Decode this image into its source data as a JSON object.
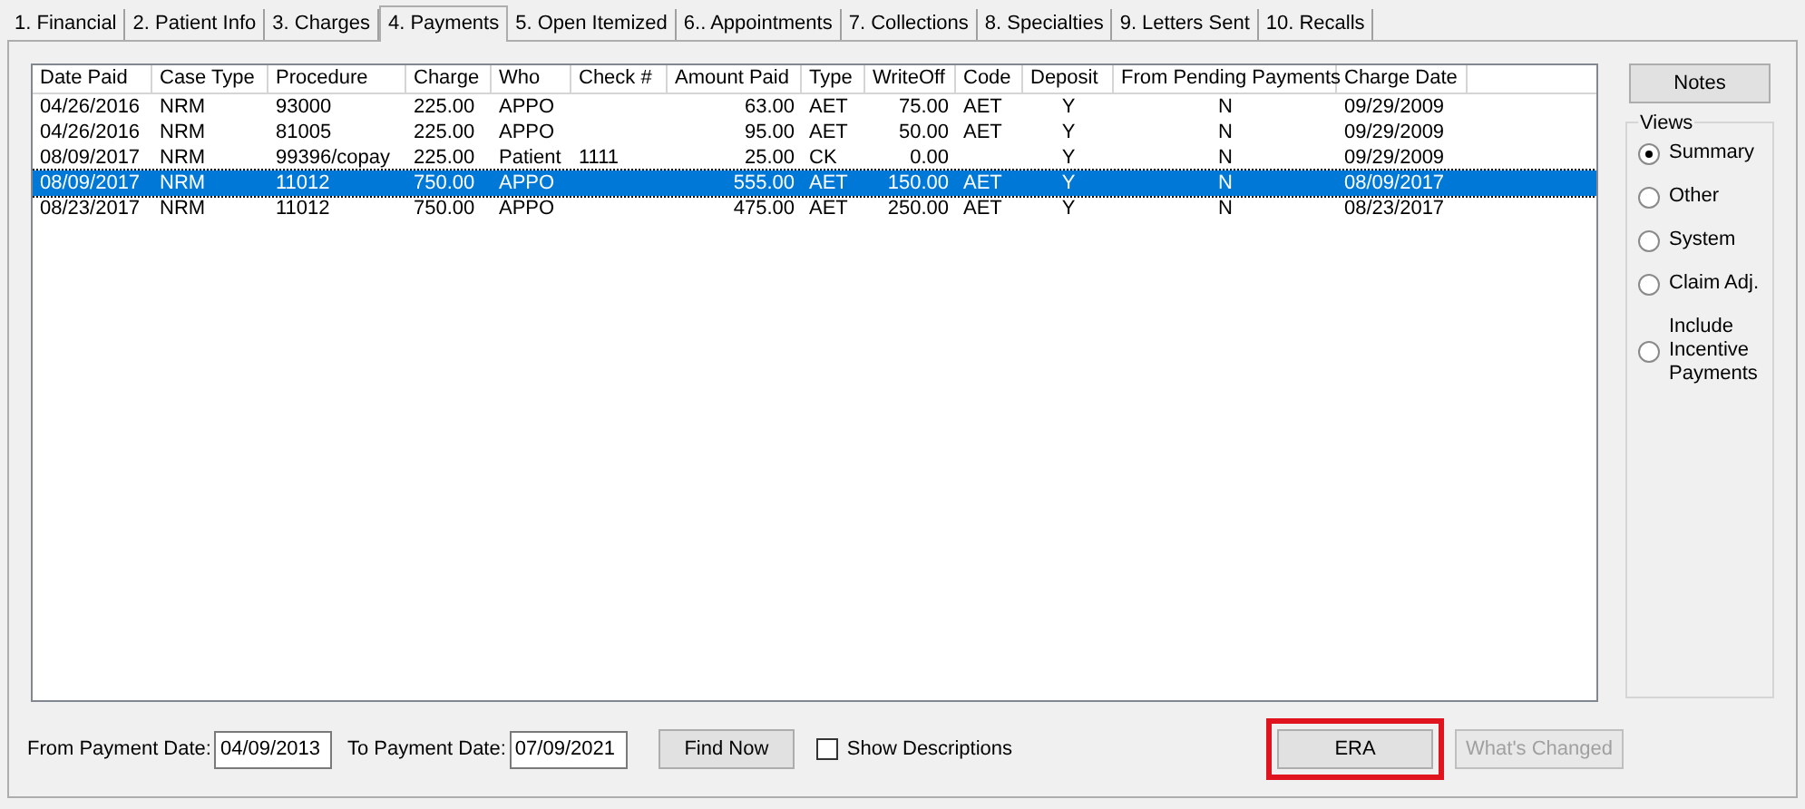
{
  "tabs": [
    {
      "label": "1. Financial",
      "selected": false
    },
    {
      "label": "2. Patient Info",
      "selected": false
    },
    {
      "label": "3. Charges",
      "selected": false
    },
    {
      "label": "4. Payments",
      "selected": true
    },
    {
      "label": "5. Open Itemized",
      "selected": false
    },
    {
      "label": "6.. Appointments",
      "selected": false
    },
    {
      "label": "7. Collections",
      "selected": false
    },
    {
      "label": "8. Specialties",
      "selected": false
    },
    {
      "label": "9. Letters Sent",
      "selected": false
    },
    {
      "label": "10. Recalls",
      "selected": false
    }
  ],
  "table": {
    "columns": [
      "Date Paid",
      "Case Type",
      "Procedure",
      "Charge",
      "Who",
      "Check #",
      "Amount Paid",
      "Type",
      "WriteOff",
      "Code",
      "Deposit",
      "From Pending Payments",
      "Charge Date"
    ],
    "rows": [
      {
        "selected": false,
        "cells": [
          "04/26/2016",
          "NRM",
          "93000",
          "225.00",
          "APPO",
          "",
          "63.00",
          "AET",
          "75.00",
          "AET",
          "Y",
          "N",
          "09/29/2009"
        ]
      },
      {
        "selected": false,
        "cells": [
          "04/26/2016",
          "NRM",
          "81005",
          "225.00",
          "APPO",
          "",
          "95.00",
          "AET",
          "50.00",
          "AET",
          "Y",
          "N",
          "09/29/2009"
        ]
      },
      {
        "selected": false,
        "cells": [
          "08/09/2017",
          "NRM",
          "99396/copay",
          "225.00",
          "Patient",
          "1111",
          "25.00",
          "CK",
          "0.00",
          "",
          "Y",
          "N",
          "09/29/2009"
        ]
      },
      {
        "selected": true,
        "cells": [
          "08/09/2017",
          "NRM",
          "11012",
          "750.00",
          "APPO",
          "",
          "555.00",
          "AET",
          "150.00",
          "AET",
          "Y",
          "N",
          "08/09/2017"
        ]
      },
      {
        "selected": false,
        "cells": [
          "08/23/2017",
          "NRM",
          "11012",
          "750.00",
          "APPO",
          "",
          "475.00",
          "AET",
          "250.00",
          "AET",
          "Y",
          "N",
          "08/23/2017"
        ]
      }
    ]
  },
  "notes_button": "Notes",
  "views": {
    "title": "Views",
    "options": [
      {
        "label": "Summary",
        "selected": true
      },
      {
        "label": "Other",
        "selected": false
      },
      {
        "label": "System",
        "selected": false
      },
      {
        "label": "Claim Adj.",
        "selected": false
      },
      {
        "label": "Include Incentive Payments",
        "selected": false
      }
    ]
  },
  "filters": {
    "from_label": "From Payment Date:",
    "from_value": "04/09/2013",
    "to_label": "To Payment Date:",
    "to_value": "07/09/2021",
    "find_button": "Find Now",
    "show_descriptions": {
      "label": "Show Descriptions",
      "checked": false
    }
  },
  "buttons": [
    {
      "label": "ERA",
      "disabled": false,
      "highlighted": true
    },
    {
      "label": "What's Changed",
      "disabled": true,
      "highlighted": false
    }
  ]
}
